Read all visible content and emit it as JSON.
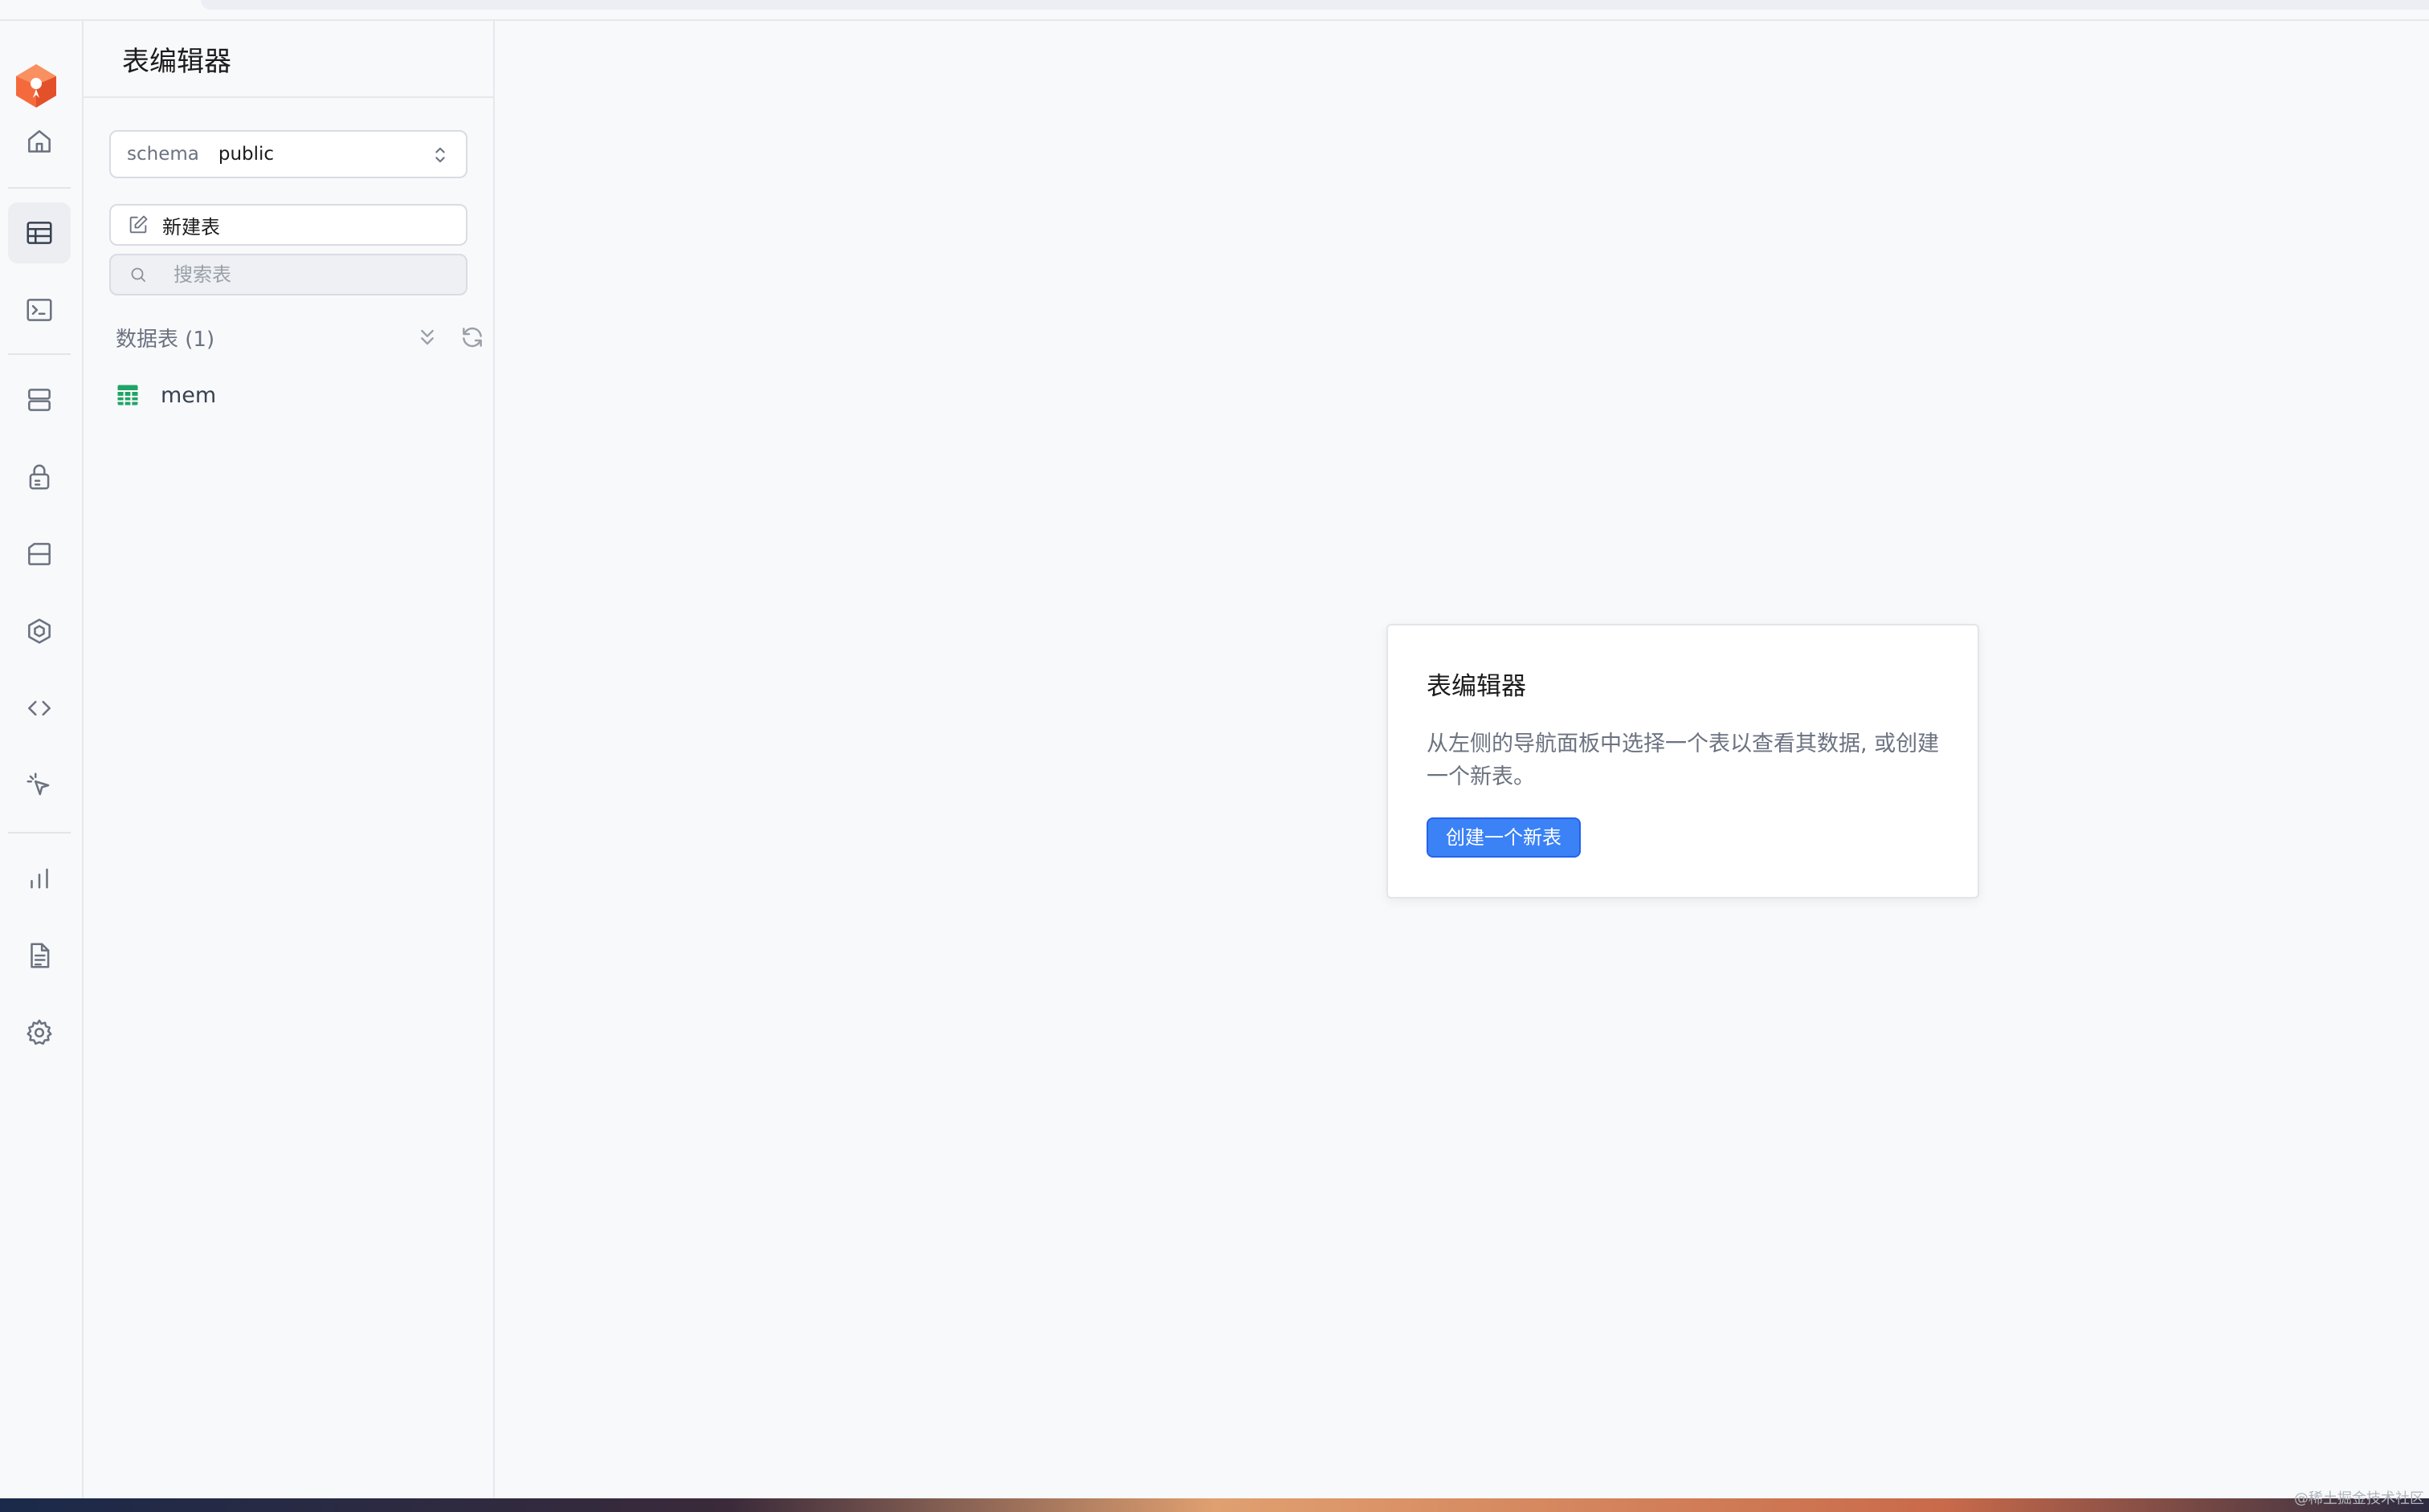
{
  "rail": {
    "items": [
      {
        "icon": "home-icon"
      },
      {
        "icon": "table-icon",
        "active": true
      },
      {
        "icon": "terminal-icon"
      },
      {
        "icon": "database-icon"
      },
      {
        "icon": "lock-icon"
      },
      {
        "icon": "storage-icon"
      },
      {
        "icon": "functions-icon"
      },
      {
        "icon": "code-icon"
      },
      {
        "icon": "pointer-icon"
      },
      {
        "icon": "chart-icon"
      },
      {
        "icon": "document-icon"
      },
      {
        "icon": "gear-icon"
      }
    ]
  },
  "panel": {
    "title": "表编辑器",
    "schema": {
      "label": "schema",
      "value": "public"
    },
    "new_table_label": "新建表",
    "search_placeholder": "搜索表",
    "section_title": "数据表 (1)",
    "tables": [
      {
        "name": "mem"
      }
    ]
  },
  "main": {
    "card": {
      "title": "表编辑器",
      "description": "从左侧的导航面板中选择一个表以查看其数据, 或创建一个新表。",
      "button_label": "创建一个新表"
    }
  },
  "colors": {
    "accent": "#3b82f6",
    "logo": "#f56a3d",
    "table_icon": "#21a366"
  },
  "watermark": "@稀土掘金技术社区"
}
